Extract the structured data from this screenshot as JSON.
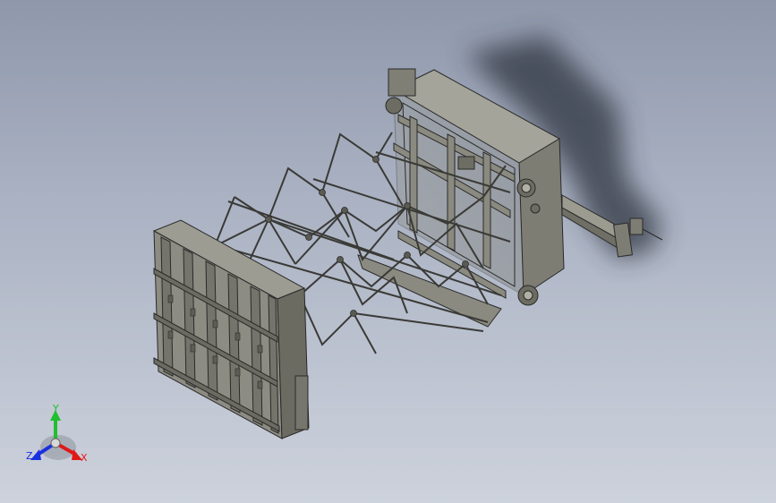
{
  "viewport": {
    "background_top": "#8f98ab",
    "background_bottom": "#cdd2dc",
    "model_color": "#8a8a80",
    "edge_color": "#2a2a2a",
    "shadow_color": "#2f3540"
  },
  "triad": {
    "x_label": "X",
    "y_label": "Y",
    "z_label": "Z",
    "x_color": "#e01818",
    "y_color": "#1fbf2f",
    "z_color": "#1a2fe0"
  }
}
